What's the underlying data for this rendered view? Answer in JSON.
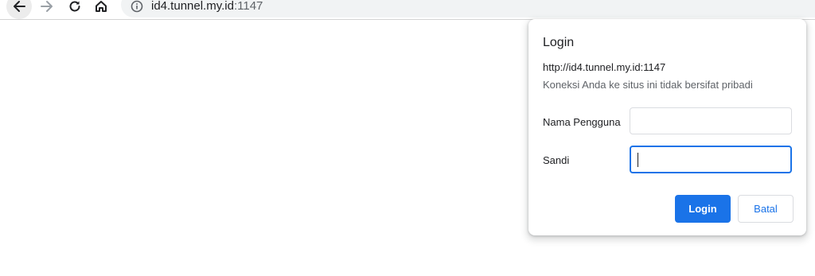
{
  "browser": {
    "url_host": "id4.tunnel.my.id",
    "url_port": ":1147",
    "icons": {
      "back": "arrow-left-icon",
      "forward": "arrow-right-icon",
      "reload": "reload-icon",
      "home": "home-icon",
      "site_info": "info-icon"
    }
  },
  "login_dialog": {
    "title": "Login",
    "origin": "http://id4.tunnel.my.id:1147",
    "warning": "Koneksi Anda ke situs ini tidak bersifat pribadi",
    "username_label": "Nama Pengguna",
    "username_value": "",
    "password_label": "Sandi",
    "password_value": "",
    "login_button": "Login",
    "cancel_button": "Batal"
  },
  "colors": {
    "accent": "#1a73e8",
    "omnibox_bg": "#f1f3f4",
    "border": "#dadce0"
  }
}
